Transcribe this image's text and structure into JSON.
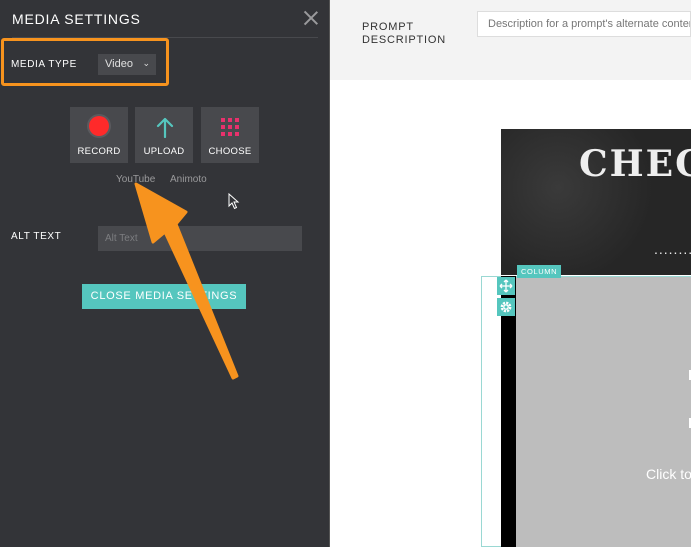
{
  "panel": {
    "title": "MEDIA SETTINGS",
    "media_type_label": "MEDIA TYPE",
    "media_type_value": "Video",
    "tiles": [
      {
        "label": "RECORD",
        "icon": "record-dot-icon"
      },
      {
        "label": "UPLOAD",
        "icon": "up-arrow-icon"
      },
      {
        "label": "CHOOSE",
        "icon": "grid-icon"
      }
    ],
    "sources": [
      "YouTube",
      "Animoto"
    ],
    "alt_text_label": "ALT TEXT",
    "alt_text_placeholder": "Alt Text",
    "close_button": "CLOSE MEDIA SETTINGS"
  },
  "editor": {
    "prompt_label": "PROMPT DESCRIPTION",
    "prompt_placeholder": "Description for a prompt's alternate content",
    "banner_text": "CHEC",
    "banner_dots": "..........",
    "column_tag": "COLUMN",
    "click_text": "Click to"
  },
  "colors": {
    "panel_bg": "#333438",
    "accent_teal": "#55c6be",
    "highlight_orange": "#f7931e",
    "record_red": "#ff2a2a",
    "choose_pink": "#e8316c"
  }
}
